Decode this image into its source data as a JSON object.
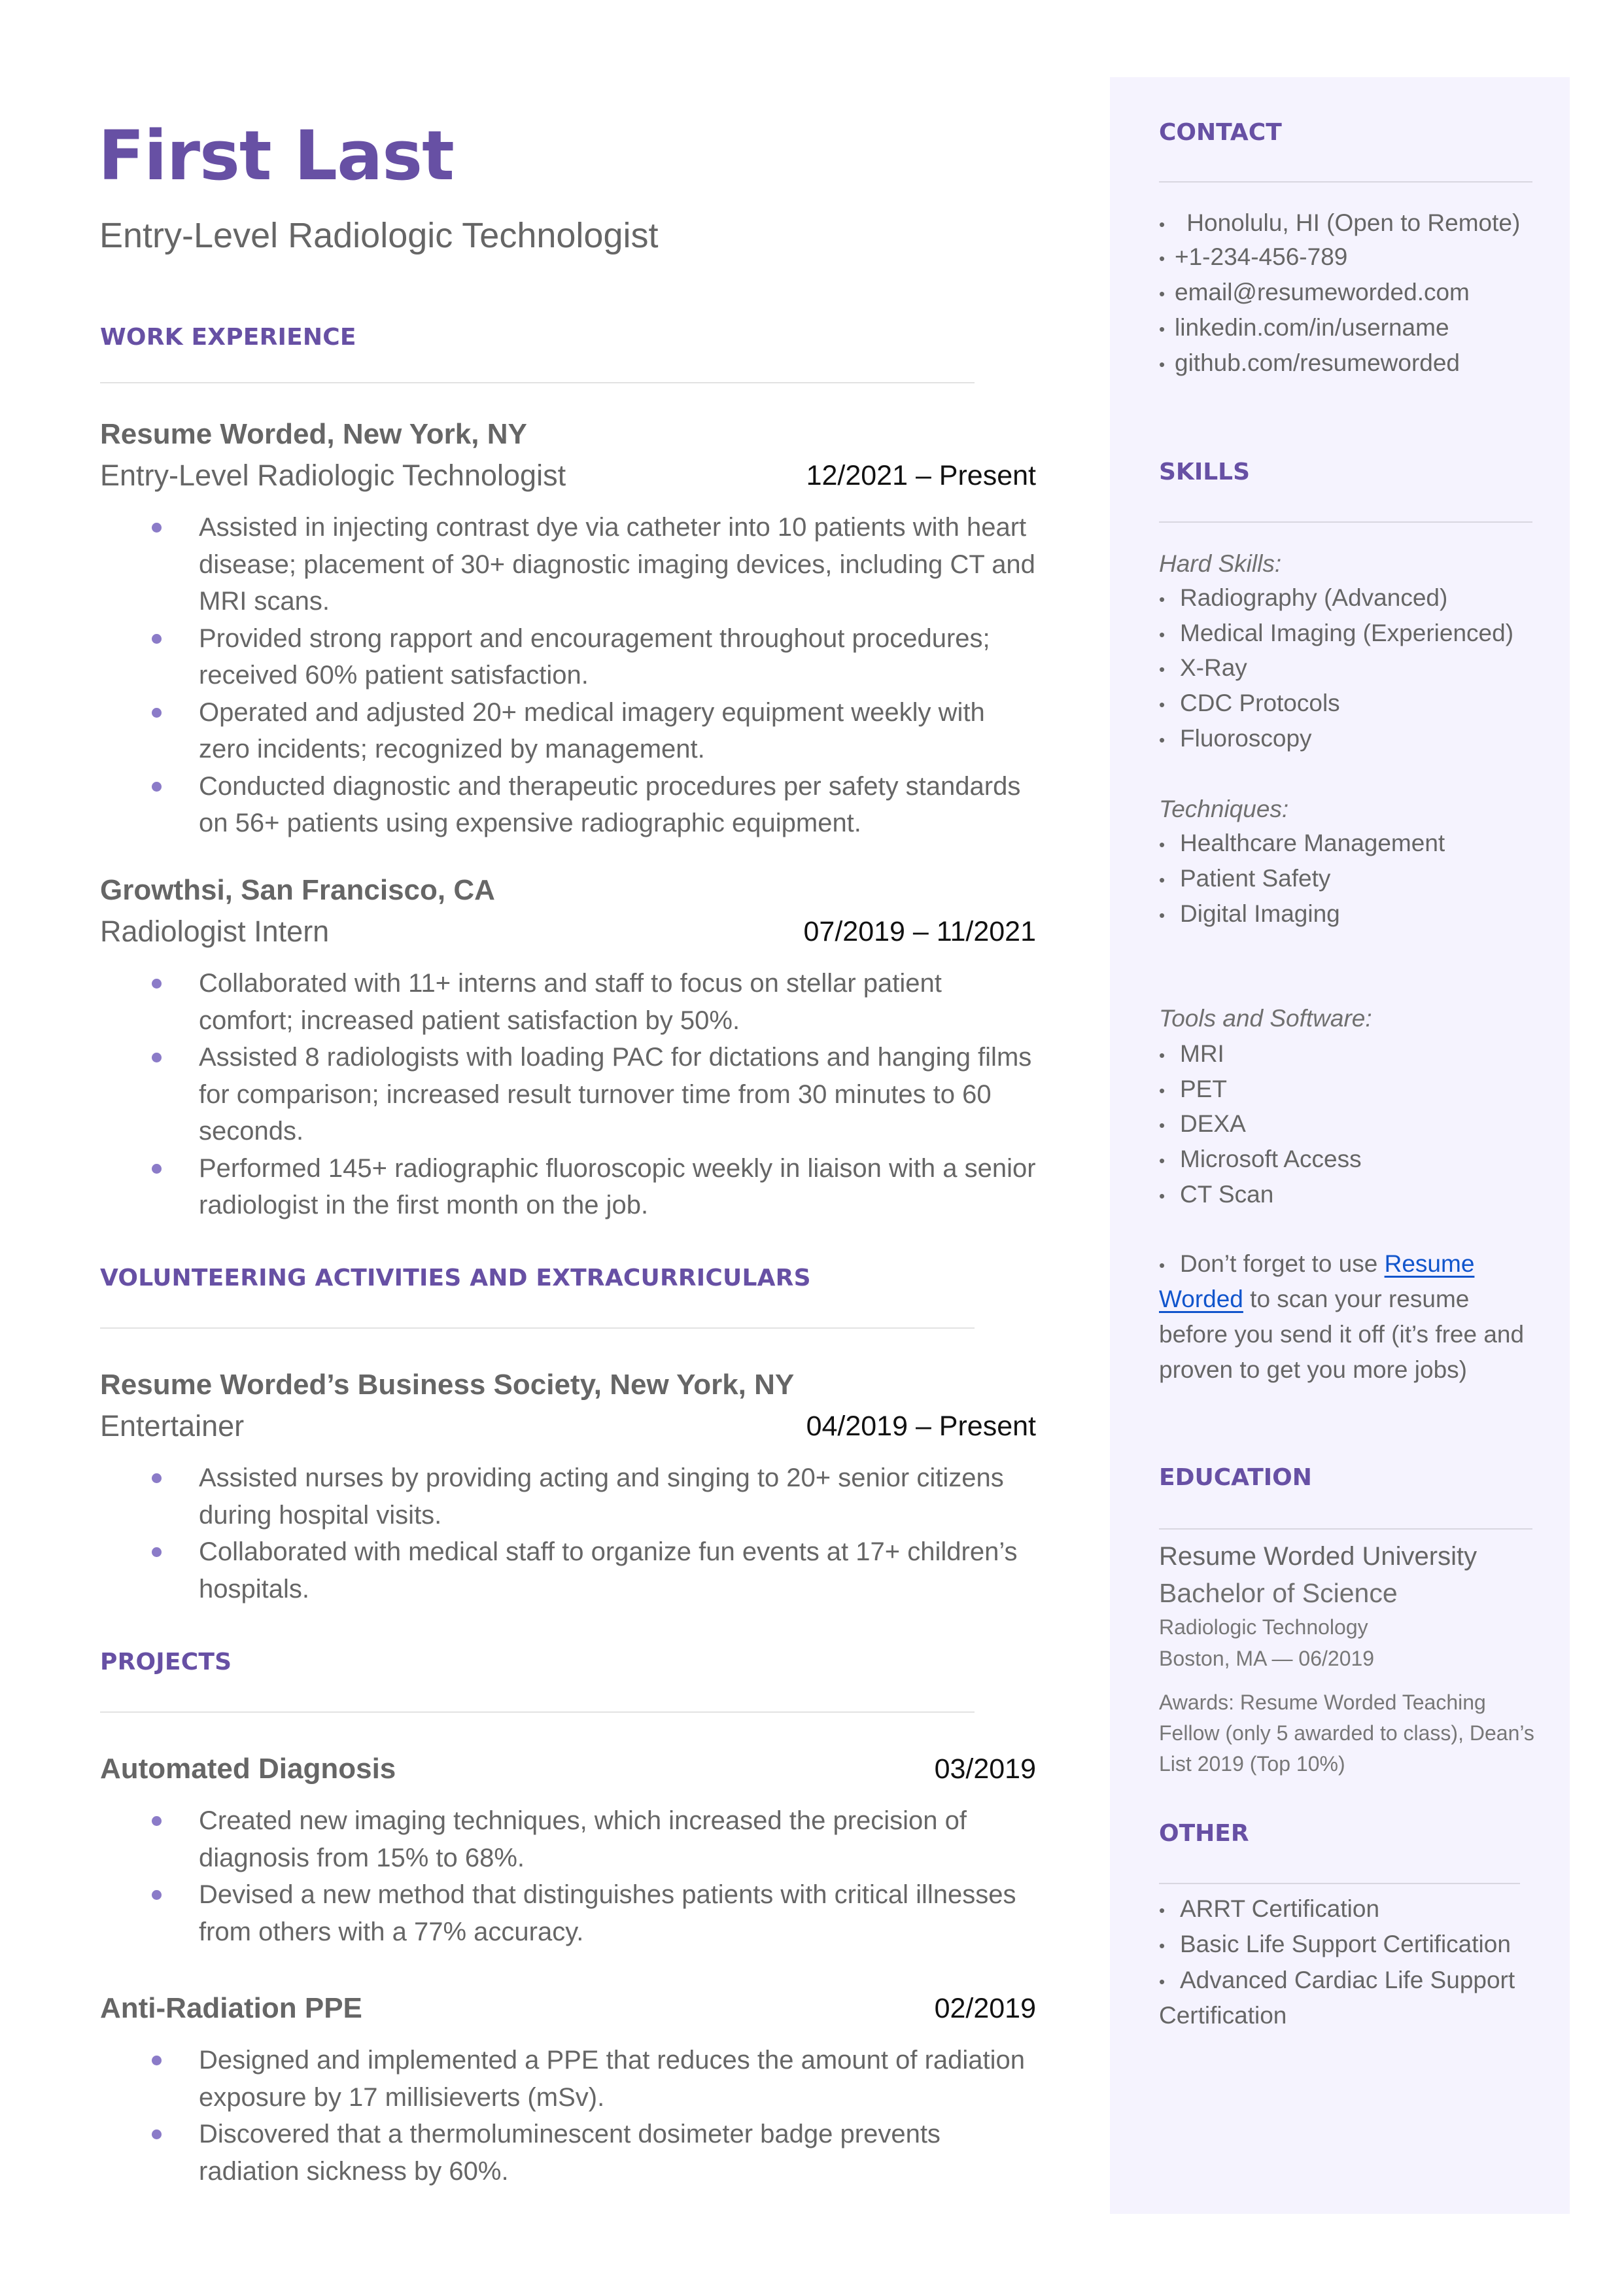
{
  "header": {
    "name": "First Last",
    "title": "Entry-Level Radiologic Technologist"
  },
  "colors": {
    "accent": "#6750A4",
    "bullet": "#8B7BC8",
    "sidebar_bg": "#F5F3FE",
    "link": "#1155CC",
    "body_text": "#666666"
  },
  "work_experience": {
    "heading": "WORK EXPERIENCE",
    "jobs": [
      {
        "company": "Resume Worded, New York, NY",
        "role": "Entry-Level Radiologic Technologist",
        "dates": "12/2021 – Present",
        "bullets": [
          "Assisted in injecting contrast dye via catheter into 10 patients with heart disease; placement of 30+ diagnostic imaging devices, including CT and MRI scans.",
          "Provided strong rapport and encouragement throughout procedures; received 60% patient satisfaction.",
          "Operated and adjusted 20+ medical imagery equipment weekly with zero incidents; recognized by management.",
          "Conducted diagnostic and therapeutic procedures per safety standards on 56+ patients using expensive radiographic equipment."
        ]
      },
      {
        "company": "Growthsi, San Francisco, CA",
        "role": "Radiologist Intern",
        "dates": "07/2019 – 11/2021",
        "bullets": [
          "Collaborated with 11+ interns and staff to focus on stellar patient comfort; increased patient satisfaction by 50%.",
          "Assisted 8 radiologists with loading PAC for dictations and hanging films for comparison; increased result turnover time from 30 minutes to 60 seconds.",
          "Performed 145+ radiographic fluoroscopic weekly in liaison with a senior radiologist in the first month on the job."
        ]
      }
    ]
  },
  "volunteering": {
    "heading": "VOLUNTEERING ACTIVITIES AND EXTRACURRICULARS",
    "entries": [
      {
        "organization": "Resume Worded’s Business Society, New York, NY",
        "role": "Entertainer",
        "dates": "04/2019 – Present",
        "bullets": [
          "Assisted nurses by providing acting and singing to 20+ senior citizens during hospital visits.",
          "Collaborated with medical staff to organize fun events at 17+ children’s hospitals."
        ]
      }
    ]
  },
  "projects": {
    "heading": "PROJECTS",
    "items": [
      {
        "title": "Automated Diagnosis",
        "date": "03/2019",
        "bullets": [
          "Created new imaging techniques, which increased the precision of diagnosis from 15% to 68%.",
          "Devised a new method that distinguishes patients with critical illnesses from others with a 77% accuracy."
        ]
      },
      {
        "title": "Anti-Radiation PPE",
        "date": "02/2019",
        "bullets": [
          "Designed and implemented a PPE that reduces the amount of radiation exposure by 17 millisieverts (mSv).",
          "Discovered that a thermoluminescent dosimeter badge prevents radiation sickness by 60%."
        ]
      }
    ]
  },
  "contact": {
    "heading": "CONTACT",
    "items": [
      " Honolulu, HI (Open to Remote)",
      "+1-234-456-789",
      "email@resumeworded.com",
      "linkedin.com/in/username",
      "github.com/resumeworded"
    ]
  },
  "skills": {
    "heading": "SKILLS",
    "hard_label": "Hard Skills:",
    "hard": [
      "Radiography (Advanced)",
      "Medical Imaging (Experienced)",
      "X-Ray",
      "CDC Protocols",
      "Fluoroscopy"
    ],
    "techniques_label": "Techniques:",
    "techniques": [
      "Healthcare Management",
      "Patient Safety",
      "Digital Imaging"
    ],
    "tools_label": "Tools and Software:",
    "tools": [
      "MRI",
      "PET",
      "DEXA",
      "Microsoft Access",
      "CT Scan"
    ],
    "tip_prefix": "Don’t forget to use ",
    "tip_link": "Resume Worded",
    "tip_line1_link": "Resume",
    "tip_line2_link": "Worded",
    "tip_line2_rest": " to scan your resume",
    "tip_line3": "before you send it off (it’s free and",
    "tip_line4": "proven to get you more jobs)"
  },
  "education": {
    "heading": "EDUCATION",
    "school": "Resume Worded University",
    "degree": "Bachelor of Science",
    "major": "Radiologic Technology",
    "location_date": "Boston, MA — 06/2019",
    "awards_lines": [
      "Awards: Resume Worded Teaching",
      "Fellow (only 5 awarded to class), Dean’s",
      "List 2019  (Top 10%)"
    ]
  },
  "other": {
    "heading": "OTHER",
    "items": [
      "ARRT Certification",
      "Basic Life Support Certification",
      "Advanced Cardiac Life Support"
    ],
    "continuation": "Certification"
  }
}
